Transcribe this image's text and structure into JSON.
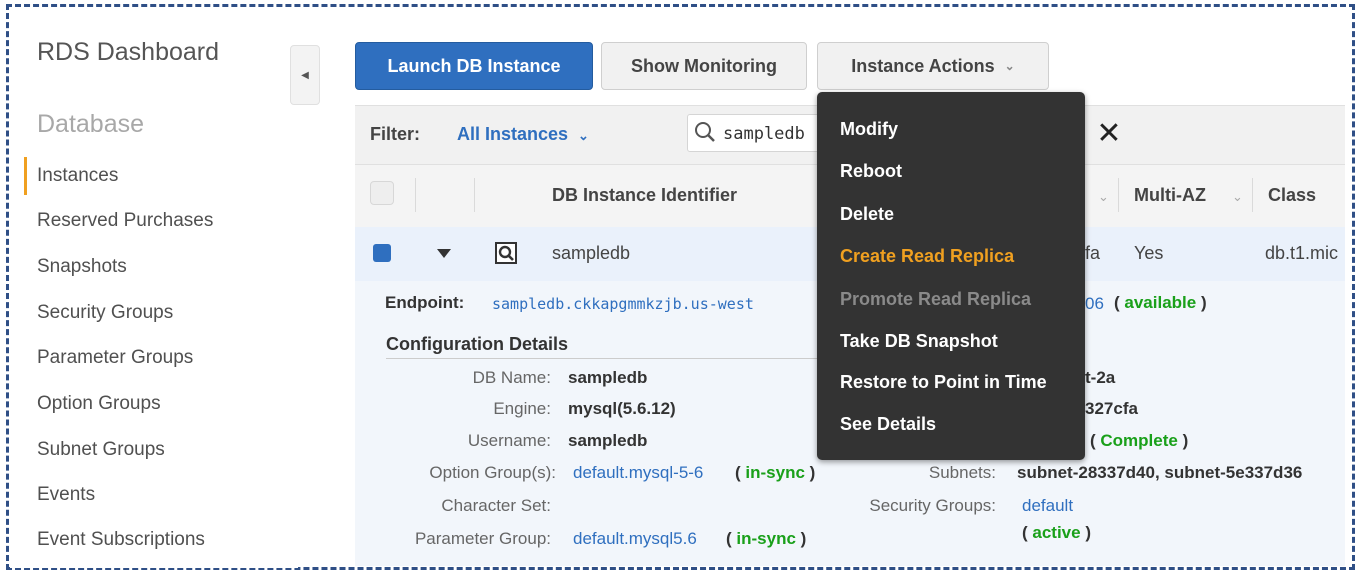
{
  "sidebar": {
    "title": "RDS Dashboard",
    "section": "Database",
    "items": [
      {
        "label": "Instances",
        "active": true
      },
      {
        "label": "Reserved Purchases"
      },
      {
        "label": "Snapshots"
      },
      {
        "label": "Security Groups"
      },
      {
        "label": "Parameter Groups"
      },
      {
        "label": "Option Groups"
      },
      {
        "label": "Subnet Groups"
      },
      {
        "label": "Events"
      },
      {
        "label": "Event Subscriptions"
      }
    ]
  },
  "toolbar": {
    "launch": "Launch DB Instance",
    "monitoring": "Show Monitoring",
    "actions": "Instance Actions"
  },
  "filter": {
    "label": "Filter:",
    "value": "All Instances",
    "search_value": "sampledb"
  },
  "table": {
    "columns": [
      "DB Instance Identifier",
      "Multi-AZ",
      "Class"
    ],
    "row": {
      "identifier": "sampledb",
      "partial": "fa",
      "multi_az": "Yes",
      "class": "db.t1.mic"
    }
  },
  "detail": {
    "endpoint_label": "Endpoint:",
    "endpoint_value": "sampledb.ckkapgmmkzjb.us-west",
    "endpoint_port": "06",
    "endpoint_status": "available",
    "config_title": "Configuration Details",
    "db_name_label": "DB Name:",
    "db_name": "sampledb",
    "engine_label": "Engine:",
    "engine": "mysql(5.6.12)",
    "username_label": "Username:",
    "username": "sampledb",
    "option_group_label": "Option Group(s):",
    "option_group": "default.mysql-5-6",
    "option_group_status": "in-sync",
    "charset_label": "Character Set:",
    "param_group_label": "Parameter Group:",
    "param_group": "default.mysql5.6",
    "param_group_status": "in-sync",
    "zone_partial": "t-2a",
    "vpc_partial": "327cfa",
    "subnet_group_status": "Complete",
    "subnets_label": "Subnets:",
    "subnets": "subnet-28337d40, subnet-5e337d36",
    "security_groups_label": "Security Groups:",
    "security_group": "default",
    "security_group_status": "active"
  },
  "menu": {
    "items": [
      {
        "label": "Modify"
      },
      {
        "label": "Reboot"
      },
      {
        "label": "Delete"
      },
      {
        "label": "Create Read Replica",
        "state": "highlighted"
      },
      {
        "label": "Promote Read Replica",
        "state": "disabled"
      },
      {
        "label": "Take DB Snapshot"
      },
      {
        "label": "Restore to Point in Time"
      },
      {
        "label": "See Details"
      }
    ]
  },
  "colors": {
    "primary": "#2f6fbf",
    "accent": "#f0a020",
    "status_green": "#1aa01a",
    "menu_bg": "#333333",
    "frame": "#2f4f86"
  }
}
